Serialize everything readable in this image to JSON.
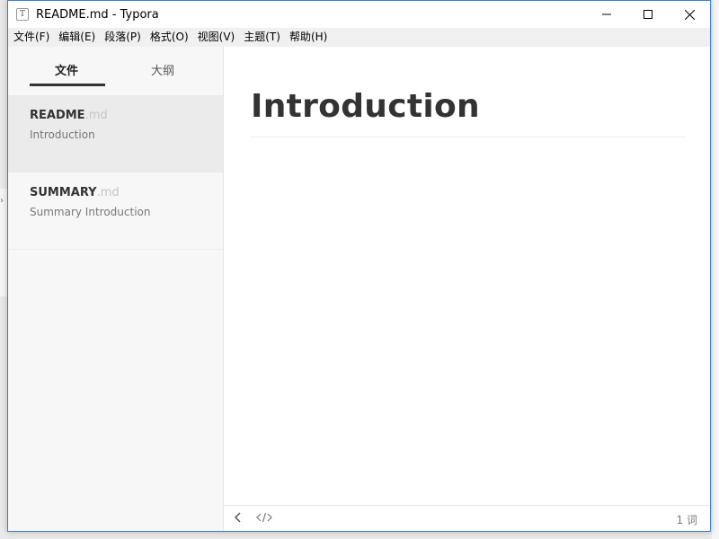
{
  "window": {
    "title": "README.md - Typora",
    "app_icon": "T",
    "controls": [
      "minimize-icon",
      "maximize-icon",
      "close-icon"
    ]
  },
  "menu": [
    "文件(F)",
    "编辑(E)",
    "段落(P)",
    "格式(O)",
    "视图(V)",
    "主题(T)",
    "帮助(H)"
  ],
  "sidebar": {
    "tabs": [
      {
        "label": "文件",
        "active": true
      },
      {
        "label": "大纲",
        "active": false
      }
    ],
    "files": [
      {
        "name": "README",
        "ext": ".md",
        "summary": "Introduction",
        "selected": true
      },
      {
        "name": "SUMMARY",
        "ext": ".md",
        "summary": "Summary Introduction",
        "selected": false
      }
    ]
  },
  "document": {
    "heading": "Introduction"
  },
  "statusbar": {
    "back_icon": "chevron-left-icon",
    "source_icon": "code-icon",
    "word_count": "1 词"
  },
  "colors": {
    "window_border": "#3c7fd1",
    "sidebar_bg": "#f7f7f7",
    "selected_item_bg": "#ebebeb",
    "heading_text": "#333333"
  }
}
